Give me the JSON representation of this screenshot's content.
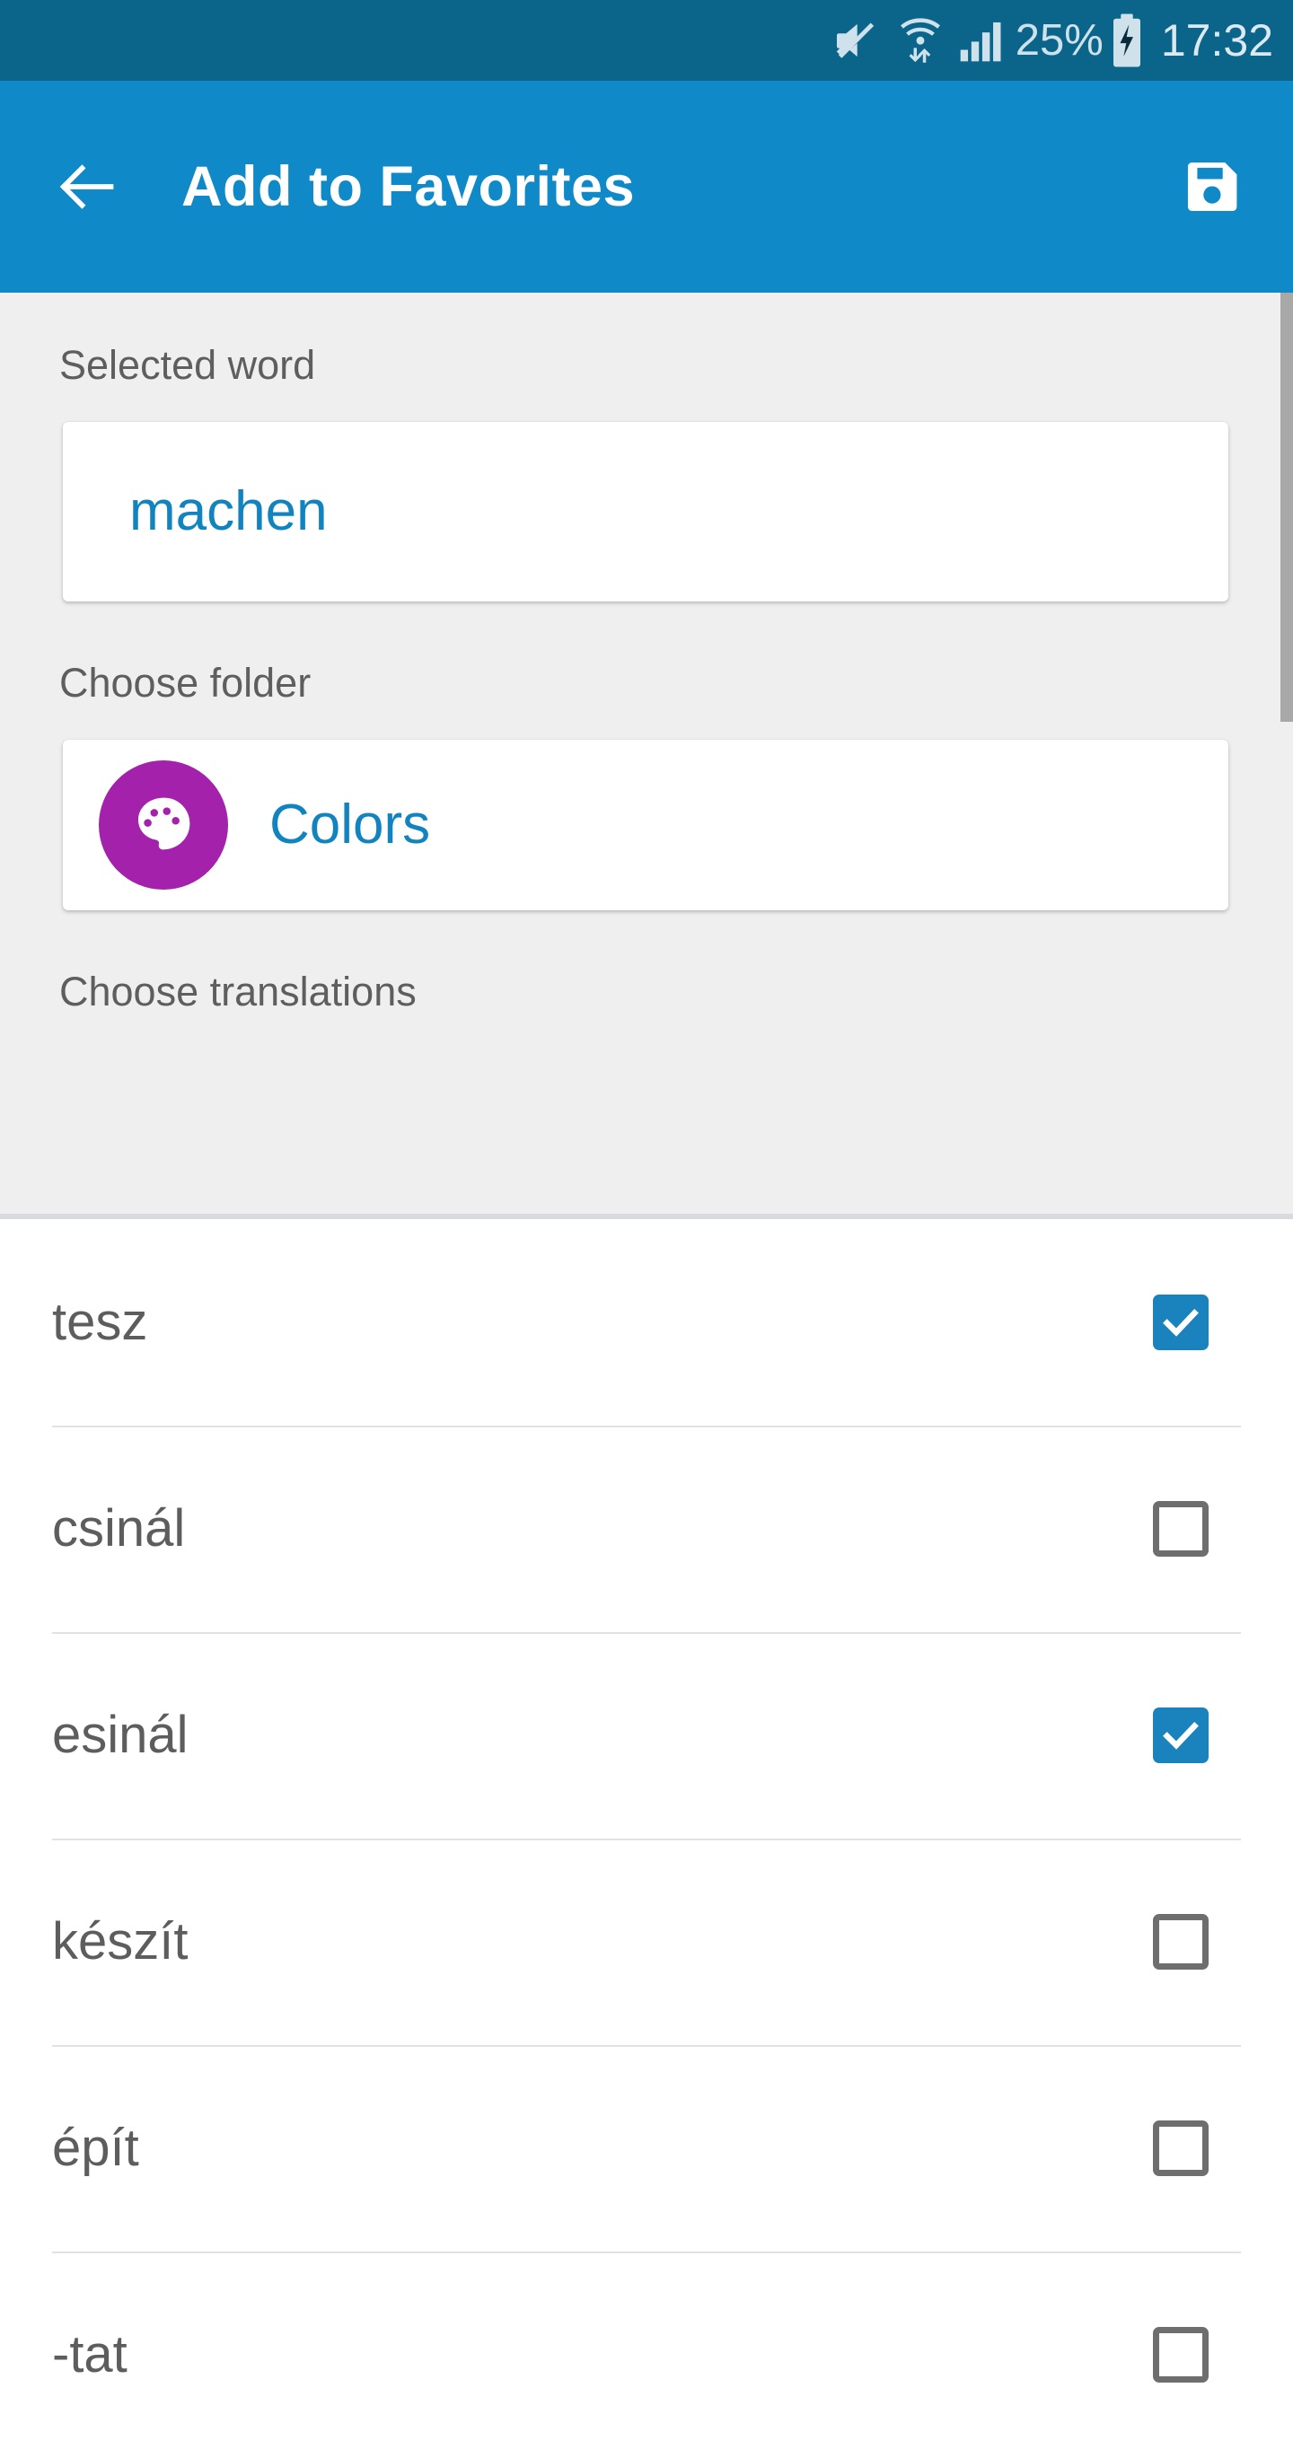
{
  "statusbar": {
    "icons": [
      "mute-icon",
      "wifi-icon",
      "signal-icon",
      "battery-charging-icon"
    ],
    "battery_percent": "25%",
    "clock": "17:32",
    "background": "#0b6489",
    "foreground": "#cfe2ec"
  },
  "appbar": {
    "title": "Add to Favorites",
    "back_icon": "arrow-left-icon",
    "save_icon": "save-floppy-icon",
    "background": "#1089c8",
    "foreground": "#ffffff"
  },
  "form": {
    "selected_word": {
      "label": "Selected word",
      "value": "machen",
      "placeholder": "Selected word",
      "value_color": "#1184bf"
    },
    "choose_folder": {
      "label": "Choose folder",
      "value": "Colors",
      "icon": "palette-icon",
      "avatar_color": "#a422ab",
      "value_color": "#1184bf"
    },
    "choose_translations": {
      "label": "Choose translations"
    }
  },
  "translations": [
    {
      "label": "tesz",
      "checked": true
    },
    {
      "label": "csinál",
      "checked": false
    },
    {
      "label": "esinál",
      "checked": true
    },
    {
      "label": "készít",
      "checked": false
    },
    {
      "label": "épít",
      "checked": false
    },
    {
      "label": "-tat",
      "checked": false
    }
  ],
  "theme": {
    "accent": "#1089c8",
    "checkbox_checked": "#1a82bd",
    "checkbox_unchecked": "#6e6e6e",
    "section_background": "#efefef",
    "text_muted": "#5e5e5e"
  }
}
